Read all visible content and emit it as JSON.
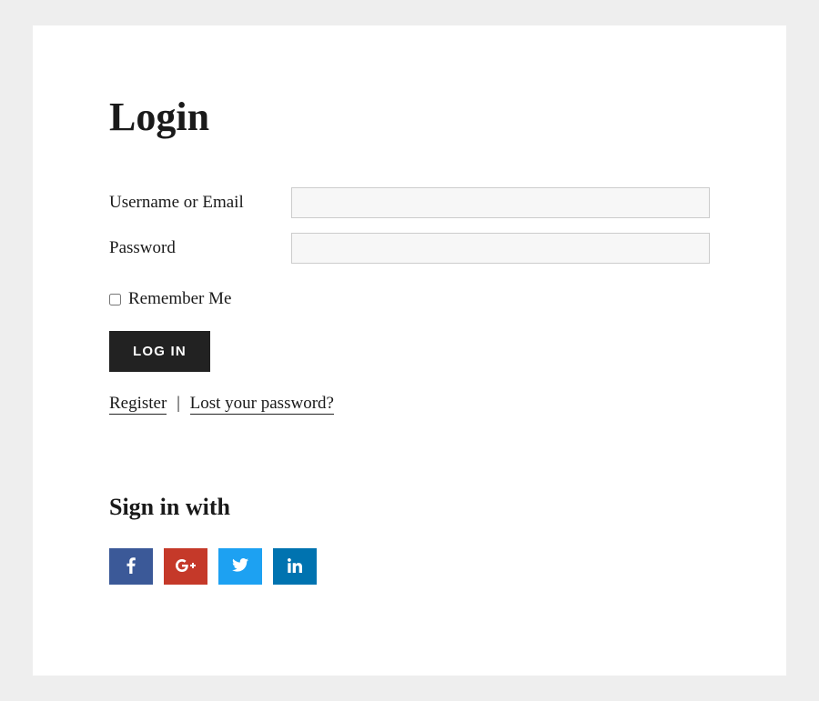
{
  "page": {
    "title": "Login"
  },
  "form": {
    "username_label": "Username or Email",
    "username_value": "",
    "password_label": "Password",
    "password_value": "",
    "remember_label": "Remember Me",
    "login_button": "Log In"
  },
  "links": {
    "register": "Register",
    "separator": "|",
    "lost_password": "Lost your password?"
  },
  "social": {
    "title": "Sign in with",
    "providers": [
      {
        "name": "facebook",
        "color": "#3b5998"
      },
      {
        "name": "google-plus",
        "color": "#c53929"
      },
      {
        "name": "twitter",
        "color": "#1da1f2"
      },
      {
        "name": "linkedin",
        "color": "#0073b0"
      }
    ]
  }
}
